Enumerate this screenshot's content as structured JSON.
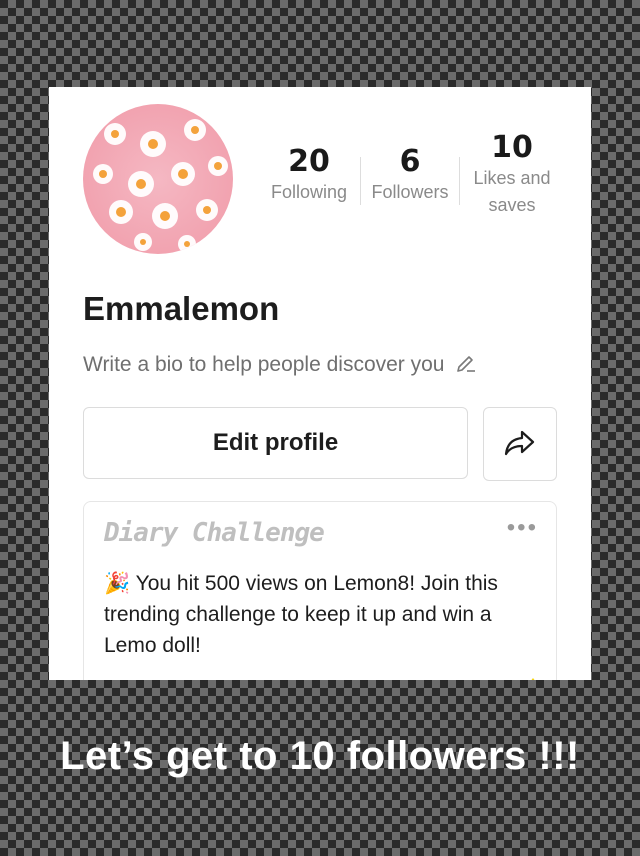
{
  "profile": {
    "name": "Emmalemon",
    "bio_placeholder": "Write a bio to help people discover you"
  },
  "stats": [
    {
      "value": "20",
      "label": "Following"
    },
    {
      "value": "6",
      "label": "Followers"
    },
    {
      "value": "10",
      "label": "Likes and saves"
    }
  ],
  "actions": {
    "edit_profile": "Edit profile"
  },
  "challenge": {
    "title": "Diary Challenge",
    "menu": "•••",
    "emoji": "🎉",
    "message": "You hit 500 views on Lemon8! Join this trending challenge to keep it up and win a Lemo doll!"
  },
  "caption": "Let’s get to 10 followers !!!",
  "colors": {
    "background_pattern": "#6b6b6b",
    "card": "#ffffff",
    "avatar_pink": "#f5b8c3",
    "accent_yellow": "#f5d20b"
  },
  "icons": [
    "pencil-icon",
    "share-icon",
    "more-icon"
  ]
}
